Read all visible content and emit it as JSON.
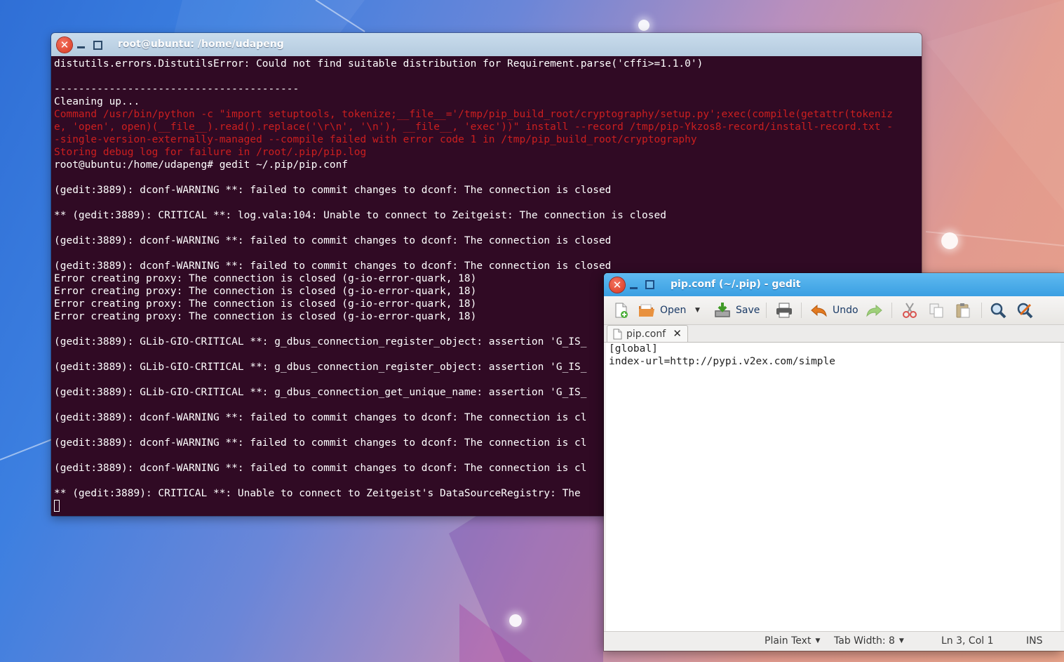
{
  "terminal": {
    "title": "root@ubuntu: /home/udapeng",
    "lines": [
      {
        "text": "distutils.errors.DistutilsError: Could not find suitable distribution for Requirement.parse('cffi>=1.1.0')",
        "style": "normal"
      },
      {
        "text": "",
        "style": "normal"
      },
      {
        "text": "----------------------------------------",
        "style": "normal"
      },
      {
        "text": "Cleaning up...",
        "style": "normal"
      },
      {
        "text": "Command /usr/bin/python -c \"import setuptools, tokenize;__file__='/tmp/pip_build_root/cryptography/setup.py';exec(compile(getattr(tokeniz",
        "style": "red"
      },
      {
        "text": "e, 'open', open)(__file__).read().replace('\\r\\n', '\\n'), __file__, 'exec'))\" install --record /tmp/pip-Ykzos8-record/install-record.txt -",
        "style": "red"
      },
      {
        "text": "-single-version-externally-managed --compile failed with error code 1 in /tmp/pip_build_root/cryptography",
        "style": "red"
      },
      {
        "text": "Storing debug log for failure in /root/.pip/pip.log",
        "style": "red"
      },
      {
        "text": "root@ubuntu:/home/udapeng# gedit ~/.pip/pip.conf",
        "style": "normal"
      },
      {
        "text": "",
        "style": "normal"
      },
      {
        "text": "(gedit:3889): dconf-WARNING **: failed to commit changes to dconf: The connection is closed",
        "style": "normal"
      },
      {
        "text": "",
        "style": "normal"
      },
      {
        "text": "** (gedit:3889): CRITICAL **: log.vala:104: Unable to connect to Zeitgeist: The connection is closed",
        "style": "normal"
      },
      {
        "text": "",
        "style": "normal"
      },
      {
        "text": "(gedit:3889): dconf-WARNING **: failed to commit changes to dconf: The connection is closed",
        "style": "normal"
      },
      {
        "text": "",
        "style": "normal"
      },
      {
        "text": "(gedit:3889): dconf-WARNING **: failed to commit changes to dconf: The connection is closed",
        "style": "normal"
      },
      {
        "text": "Error creating proxy: The connection is closed (g-io-error-quark, 18)",
        "style": "normal"
      },
      {
        "text": "Error creating proxy: The connection is closed (g-io-error-quark, 18)",
        "style": "normal"
      },
      {
        "text": "Error creating proxy: The connection is closed (g-io-error-quark, 18)",
        "style": "normal"
      },
      {
        "text": "Error creating proxy: The connection is closed (g-io-error-quark, 18)",
        "style": "normal"
      },
      {
        "text": "",
        "style": "normal"
      },
      {
        "text": "(gedit:3889): GLib-GIO-CRITICAL **: g_dbus_connection_register_object: assertion 'G_IS_",
        "style": "normal"
      },
      {
        "text": "",
        "style": "normal"
      },
      {
        "text": "(gedit:3889): GLib-GIO-CRITICAL **: g_dbus_connection_register_object: assertion 'G_IS_",
        "style": "normal"
      },
      {
        "text": "",
        "style": "normal"
      },
      {
        "text": "(gedit:3889): GLib-GIO-CRITICAL **: g_dbus_connection_get_unique_name: assertion 'G_IS_",
        "style": "normal"
      },
      {
        "text": "",
        "style": "normal"
      },
      {
        "text": "(gedit:3889): dconf-WARNING **: failed to commit changes to dconf: The connection is cl",
        "style": "normal"
      },
      {
        "text": "",
        "style": "normal"
      },
      {
        "text": "(gedit:3889): dconf-WARNING **: failed to commit changes to dconf: The connection is cl",
        "style": "normal"
      },
      {
        "text": "",
        "style": "normal"
      },
      {
        "text": "(gedit:3889): dconf-WARNING **: failed to commit changes to dconf: The connection is cl",
        "style": "normal"
      },
      {
        "text": "",
        "style": "normal"
      },
      {
        "text": "** (gedit:3889): CRITICAL **: Unable to connect to Zeitgeist's DataSourceRegistry: The",
        "style": "normal"
      }
    ]
  },
  "gedit": {
    "title": "pip.conf (~/.pip) - gedit",
    "toolbar": {
      "open_label": "Open",
      "save_label": "Save",
      "undo_label": "Undo"
    },
    "tab": {
      "label": "pip.conf",
      "close_glyph": "✕"
    },
    "document_lines": [
      "[global]",
      "index-url=http://pypi.v2ex.com/simple"
    ],
    "status": {
      "language": "Plain Text",
      "tab_width": "Tab Width: 8",
      "position": "Ln 3, Col 1",
      "mode": "INS"
    }
  },
  "window_controls": {
    "close_glyph": "✕"
  },
  "colors": {
    "terminal_bg": "#300a24",
    "terminal_error": "#cc1f1f",
    "gedit_titlebar": "#3a9fe2",
    "terminal_titlebar": "#b5cbdf"
  }
}
